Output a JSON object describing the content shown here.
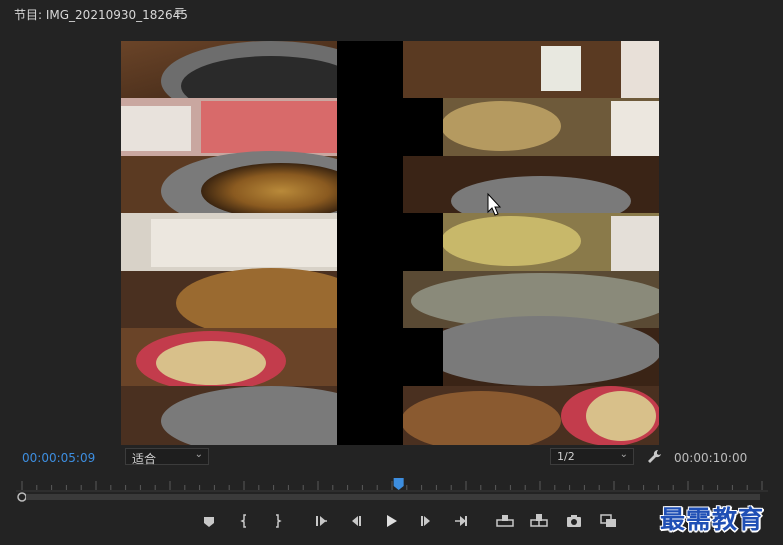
{
  "panel": {
    "title": "节目: IMG_20210930_182645",
    "menu_icon": "hamburger-icon"
  },
  "viewer": {
    "content": "video-frame-hotpot-split-strips"
  },
  "controls": {
    "current_timecode": "00:00:05:09",
    "fit_value": "适合",
    "resolution_value": "1/2",
    "settings_icon": "wrench-icon",
    "duration_timecode": "00:00:10:00",
    "playhead_position": 0.509
  },
  "transport": {
    "buttons": [
      "add-marker-icon",
      "mark-in-icon",
      "mark-out-icon",
      "go-to-in-icon",
      "step-back-icon",
      "play-icon",
      "step-forward-icon",
      "go-to-out-icon",
      "lift-icon",
      "extract-icon",
      "export-frame-icon",
      "compare-icon"
    ]
  },
  "watermark": {
    "text": "最需教育"
  },
  "colors": {
    "timecode_active": "#3d8ee0",
    "playhead": "#3d8ee0",
    "background": "#232323"
  }
}
